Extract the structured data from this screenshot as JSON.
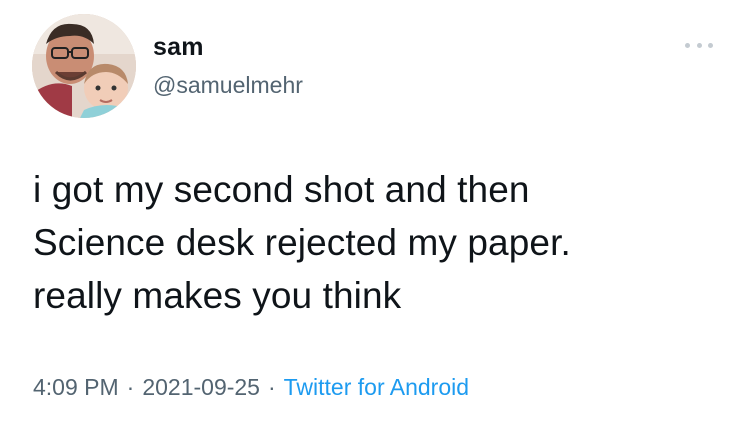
{
  "author": {
    "display_name": "sam",
    "handle": "@samuelmehr"
  },
  "tweet": {
    "lines": [
      "i got my second shot and then",
      "Science desk rejected my paper.",
      "really makes you think"
    ],
    "time": "4:09 PM",
    "separator": "·",
    "date": "2021-09-25",
    "source": "Twitter for Android"
  },
  "icons": {
    "more": "more-horizontal-icon",
    "avatar": "profile-photo"
  },
  "colors": {
    "text": "#0f1419",
    "secondary": "#536471",
    "link": "#1d9bf0",
    "background": "#ffffff"
  }
}
